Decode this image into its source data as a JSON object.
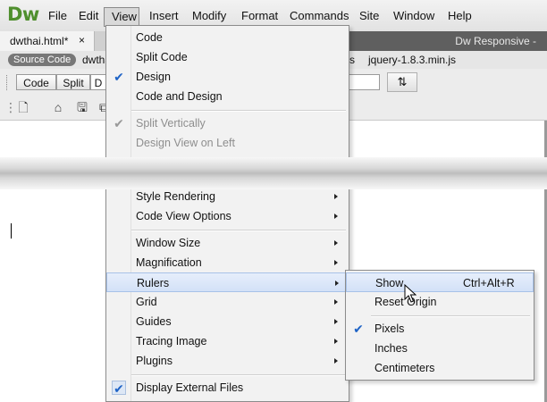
{
  "app": {
    "logo": "Dw",
    "menus": [
      "File",
      "Edit",
      "View",
      "Insert",
      "Modify",
      "Format",
      "Commands",
      "Site",
      "Window",
      "Help"
    ]
  },
  "tabs": {
    "document": "dwthai.html*",
    "close": "×",
    "workspace": "Dw Responsive -"
  },
  "related_files": {
    "source_code": "Source Code",
    "file1": "dwtha",
    "file2": "ss",
    "file3": "jquery-1.8.3.min.js"
  },
  "doc_toolbar": {
    "code": "Code",
    "split": "Split",
    "design_partial": "D"
  },
  "view_menu": {
    "items": [
      {
        "label": "Code"
      },
      {
        "label": "Split Code"
      },
      {
        "label": "Design",
        "checked": true
      },
      {
        "label": "Code and Design"
      },
      {
        "label": "Split Vertically",
        "disabled": true,
        "checked": true
      },
      {
        "label": "Design View on Left",
        "disabled": true
      },
      {
        "label": "Style Rendering",
        "submenu": true
      },
      {
        "label": "Code View Options",
        "submenu": true
      },
      {
        "label": "Window Size",
        "submenu": true
      },
      {
        "label": "Magnification",
        "submenu": true
      },
      {
        "label": "Rulers",
        "submenu": true,
        "highlighted": true
      },
      {
        "label": "Grid",
        "submenu": true
      },
      {
        "label": "Guides",
        "submenu": true
      },
      {
        "label": "Tracing Image",
        "submenu": true
      },
      {
        "label": "Plugins",
        "submenu": true
      },
      {
        "label": "Display External Files",
        "checked": true
      }
    ]
  },
  "rulers_menu": {
    "items": [
      {
        "label": "Show",
        "shortcut": "Ctrl+Alt+R",
        "highlighted": true
      },
      {
        "label": "Reset Origin"
      },
      {
        "label": "Pixels",
        "checked": true
      },
      {
        "label": "Inches"
      },
      {
        "label": "Centimeters"
      }
    ]
  },
  "colors": {
    "logo": "#4f8f2d",
    "check": "#1e63c6",
    "highlight": "#d3e1f7"
  }
}
